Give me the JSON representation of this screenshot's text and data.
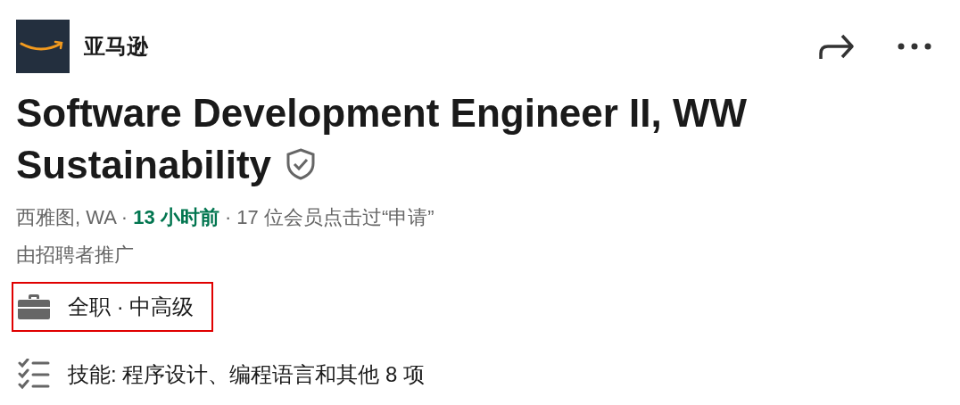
{
  "company": {
    "name": "亚马逊"
  },
  "title": "Software Development Engineer II, WW Sustainability",
  "verified": true,
  "meta": [
    {
      "text": "西雅图, WA · ",
      "emphasis": false
    },
    {
      "text": "13 小时前",
      "emphasis": true
    },
    {
      "text": " · 17 位会员点击过“申请”",
      "emphasis": false
    }
  ],
  "promoted": "由招聘者推广",
  "insights": [
    {
      "kind": "job-type",
      "text": "全职 · 中高级",
      "highlighted": true
    },
    {
      "kind": "skills",
      "text": "技能: 程序设计、编程语言和其他 8 项",
      "highlighted": false
    }
  ]
}
